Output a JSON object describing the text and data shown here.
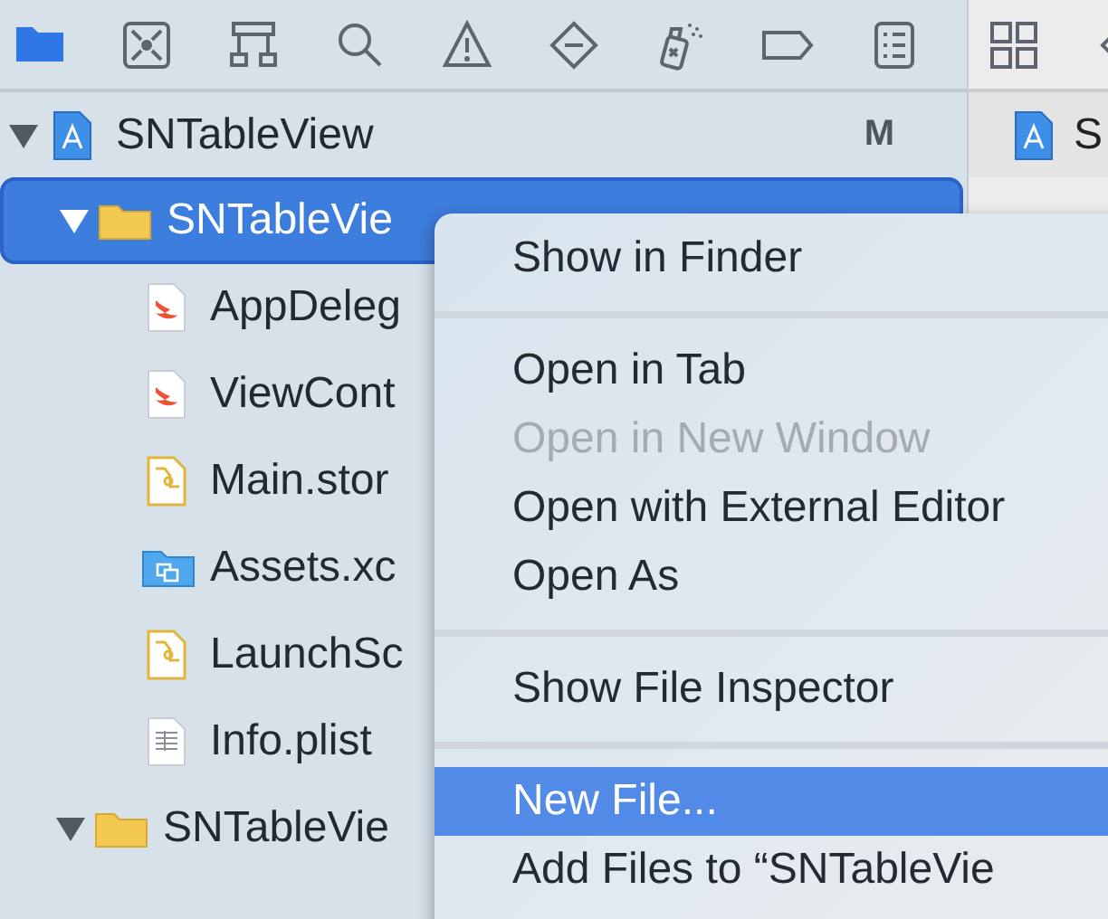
{
  "navigator_toolbar": {
    "icons": [
      {
        "kind": "folder",
        "selected": true
      },
      {
        "kind": "source-control",
        "selected": false
      },
      {
        "kind": "hierarchy",
        "selected": false
      },
      {
        "kind": "search",
        "selected": false
      },
      {
        "kind": "warning",
        "selected": false
      },
      {
        "kind": "test",
        "selected": false
      },
      {
        "kind": "debug",
        "selected": false
      },
      {
        "kind": "breakpoint",
        "selected": false
      },
      {
        "kind": "report",
        "selected": false
      }
    ]
  },
  "navigator": {
    "items": [
      {
        "kind": "project",
        "name": "SNTableView",
        "badge": "M",
        "expanded": true,
        "selected": false,
        "children": [
          {
            "kind": "folder",
            "name": "SNTableVie",
            "expanded": true,
            "selected": true,
            "children": [
              {
                "kind": "swift",
                "name": "AppDeleg",
                "selected": false
              },
              {
                "kind": "swift",
                "name": "ViewCont",
                "selected": false
              },
              {
                "kind": "storyboard",
                "name": "Main.stor",
                "selected": false
              },
              {
                "kind": "assets",
                "name": "Assets.xc",
                "selected": false
              },
              {
                "kind": "storyboard",
                "name": "LaunchSc",
                "selected": false
              },
              {
                "kind": "plist",
                "name": "Info.plist",
                "selected": false
              }
            ]
          },
          {
            "kind": "folder",
            "name": "SNTableVie",
            "expanded": true,
            "selected": false
          }
        ]
      }
    ]
  },
  "editor": {
    "toolbar_icons": [
      {
        "kind": "grid"
      },
      {
        "kind": "back"
      }
    ],
    "tab": {
      "label": "S"
    }
  },
  "context_menu": {
    "groups": [
      {
        "items": [
          {
            "label": "Show in Finder",
            "disabled": false,
            "selected": false
          }
        ]
      },
      {
        "items": [
          {
            "label": "Open in Tab",
            "disabled": false,
            "selected": false
          },
          {
            "label": "Open in New Window",
            "disabled": true,
            "selected": false
          },
          {
            "label": "Open with External Editor",
            "disabled": false,
            "selected": false
          },
          {
            "label": "Open As",
            "disabled": false,
            "selected": false
          }
        ]
      },
      {
        "items": [
          {
            "label": "Show File Inspector",
            "disabled": false,
            "selected": false
          }
        ]
      },
      {
        "items": [
          {
            "label": "New File...",
            "disabled": false,
            "selected": true
          },
          {
            "label": "Add Files to “SNTableVie",
            "disabled": false,
            "selected": false
          }
        ]
      }
    ]
  }
}
